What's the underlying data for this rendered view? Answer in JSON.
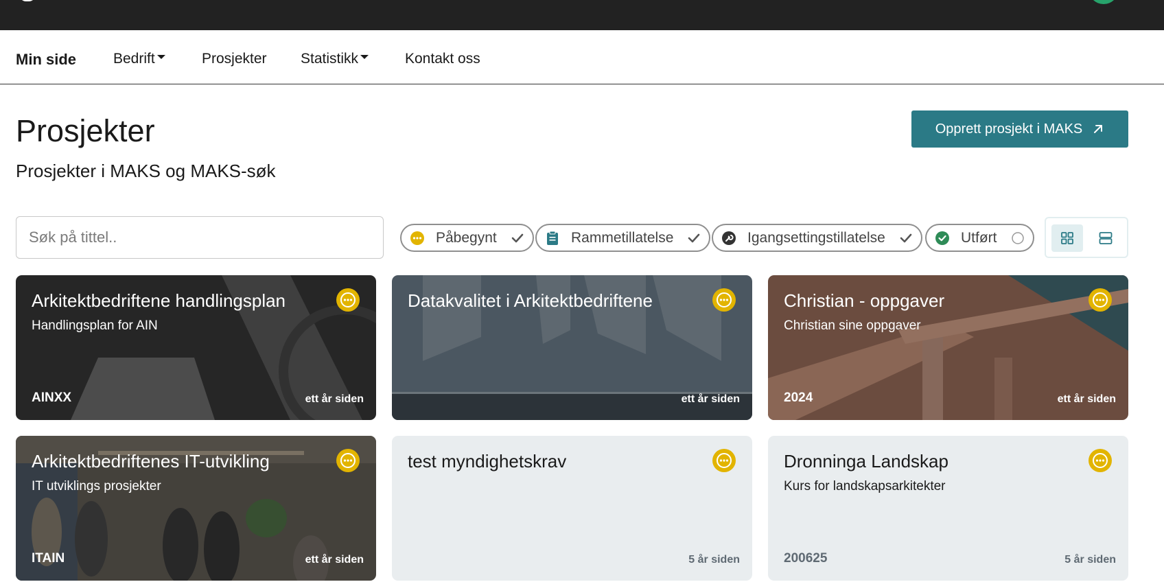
{
  "nav": {
    "home": "Min side",
    "items": [
      {
        "label": "Bedrift",
        "dropdown": true
      },
      {
        "label": "Prosjekter",
        "dropdown": false
      },
      {
        "label": "Statistikk",
        "dropdown": true
      },
      {
        "label": "Kontakt oss",
        "dropdown": false
      }
    ]
  },
  "header": {
    "title": "Prosjekter",
    "subtitle": "Prosjekter i MAKS og MAKS-søk",
    "create_button": "Opprett prosjekt i MAKS",
    "create_icon": "arrow-up-right-icon"
  },
  "search": {
    "placeholder": "Søk på tittel..",
    "value": ""
  },
  "filters": [
    {
      "label": "Påbegynt",
      "icon": "ellipsis-circle-icon",
      "selected": true
    },
    {
      "label": "Rammetillatelse",
      "icon": "clipboard-icon",
      "selected": true
    },
    {
      "label": "Igangsettingstillatelse",
      "icon": "wrench-icon",
      "selected": true
    },
    {
      "label": "Utført",
      "icon": "check-circle-icon",
      "selected": false
    }
  ],
  "view": {
    "active": "grid",
    "options": [
      "grid-view-icon",
      "list-view-icon"
    ]
  },
  "projects": [
    {
      "title": "Arkitektbedriftene handlingsplan",
      "description": "Handlingsplan for AIN",
      "code": "AINXX",
      "age": "ett år siden",
      "status": "Påbegynt"
    },
    {
      "title": "Datakvalitet i Arkitektbedriftene",
      "description": "",
      "code": "",
      "age": "ett år siden",
      "status": "Påbegynt"
    },
    {
      "title": "Christian - oppgaver",
      "description": "Christian sine oppgaver",
      "code": "2024",
      "age": "ett år siden",
      "status": "Påbegynt"
    },
    {
      "title": "Arkitektbedriftenes IT-utvikling",
      "description": "IT utviklings prosjekter",
      "code": "ITAIN",
      "age": "ett år siden",
      "status": "Påbegynt"
    },
    {
      "title": "test myndighetskrav",
      "description": "",
      "code": "",
      "age": "5 år siden",
      "status": "Påbegynt"
    },
    {
      "title": "Dronninga Landskap",
      "description": "Kurs for landskapsarkitekter",
      "code": "200625",
      "age": "5 år siden",
      "status": "Påbegynt"
    }
  ],
  "colors": {
    "topbar": "#222222",
    "accent": "#2b7a86",
    "status_yellow": "#e2b400",
    "success": "#2e8b57",
    "card_light": "#e9edef"
  }
}
